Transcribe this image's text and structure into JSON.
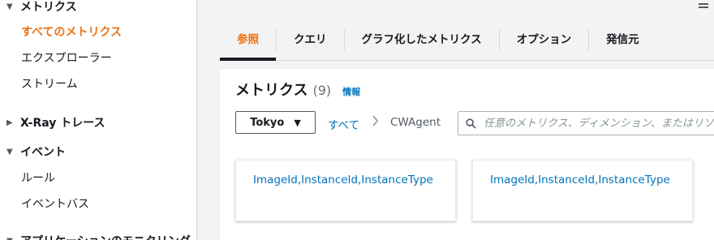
{
  "sidebar": {
    "sections": [
      {
        "label": "メトリクス",
        "expanded": true
      },
      {
        "label": "X-Ray トレース",
        "expanded": false
      },
      {
        "label": "イベント",
        "expanded": true
      },
      {
        "label": "アプリケーションのモニタリング",
        "expanded": true
      }
    ],
    "metrics_items": [
      "すべてのメトリクス",
      "エクスプローラー",
      "ストリーム"
    ],
    "events_items": [
      "ルール",
      "イベントバス"
    ]
  },
  "tabs": [
    "参照",
    "クエリ",
    "グラフ化したメトリクス",
    "オプション",
    "発信元"
  ],
  "panel": {
    "title": "メトリクス",
    "count": "(9)",
    "info_link": "情報",
    "region": "Tokyo",
    "breadcrumb_all": "すべて",
    "breadcrumb_namespace": "CWAgent",
    "search_placeholder": "任意のメトリクス、ディメンション、またはリソース ID を検索"
  },
  "cards": [
    "ImageId,InstanceId,InstanceType",
    "ImageId,InstanceId,InstanceType"
  ],
  "colors": {
    "accent": "#ec7211",
    "link": "#0073bb"
  }
}
